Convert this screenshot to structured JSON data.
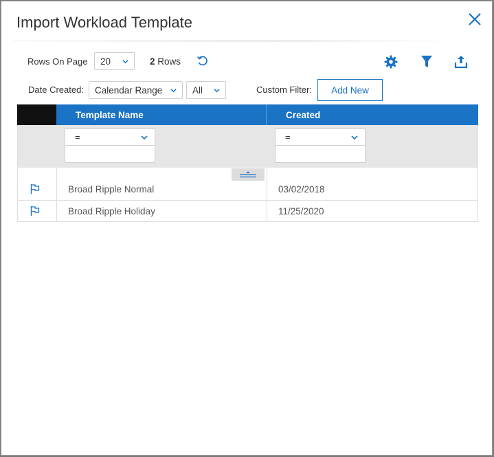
{
  "dialog": {
    "title": "Import Workload Template"
  },
  "toolbar": {
    "rows_on_page_label": "Rows On Page",
    "rows_on_page_value": "20",
    "row_count": "2",
    "row_count_label": "Rows",
    "icons": [
      "refresh-icon",
      "gear-icon",
      "filter-icon",
      "export-icon"
    ]
  },
  "filters": {
    "date_created_label": "Date Created:",
    "date_range_value": "Calendar Range",
    "date_scope_value": "All",
    "custom_filter_label": "Custom Filter:",
    "add_new_label": "Add New"
  },
  "grid": {
    "columns": [
      "Template Name",
      "Created"
    ],
    "filter_operators": [
      "=",
      "="
    ],
    "rows": [
      {
        "name": "Broad Ripple Normal",
        "created": "03/02/2018"
      },
      {
        "name": "Broad Ripple Holiday",
        "created": "11/25/2020"
      }
    ]
  },
  "colors": {
    "accent": "#1a73c4",
    "header_dark": "#111111",
    "filter_bg": "#e6e6e6"
  }
}
